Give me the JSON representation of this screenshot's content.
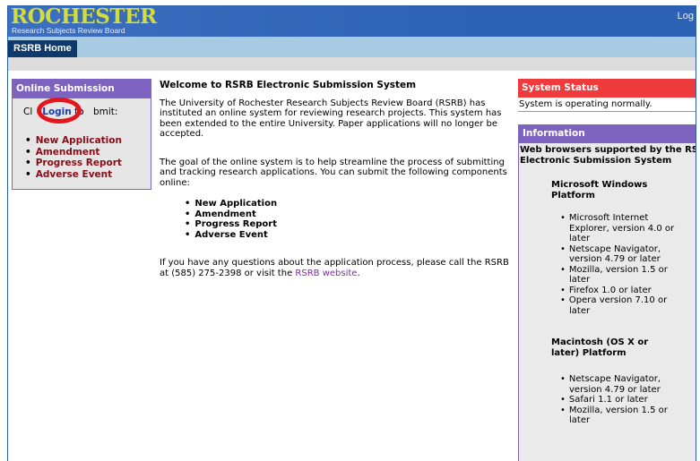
{
  "header": {
    "logo_main": "ROCHESTER",
    "logo_sub": "Research Subjects Review Board",
    "log_link": "Log"
  },
  "nav": {
    "tab_home": "RSRB Home"
  },
  "left_panel": {
    "title": "Online Submission",
    "prefix": "Cl",
    "login_link": "Login",
    "to": " to ",
    "suffix": "bmit:",
    "items": [
      "New Application",
      "Amendment",
      "Progress Report",
      "Adverse Event"
    ]
  },
  "center": {
    "title": "Welcome to RSRB Electronic Submission System",
    "para1": "The University of Rochester Research Subjects Review Board (RSRB) has instituted an online system for reviewing research projects.  This system has been extended to the entire University.  Paper applications will no longer be accepted.",
    "para2": "The goal of the online system is to help streamline the process of submitting and tracking research applications.  You can submit the following components online:",
    "items": [
      "New Application",
      "Amendment",
      "Progress Report",
      "Adverse Event"
    ],
    "contact_prefix": "If you have any questions about the application process, please call the RSRB at (585) 275-2398 or visit the ",
    "contact_link": "RSRB website",
    "contact_suffix": "."
  },
  "status": {
    "title": "System Status",
    "text": "System is operating normally."
  },
  "info": {
    "title": "Information",
    "heading": "Web browsers supported by the RSRB Electronic Submission System",
    "windows_title": "Microsoft Windows Platform",
    "windows_items": [
      "Microsoft Internet Explorer, version 4.0 or later",
      "Netscape Navigator, version 4.79 or later",
      "Mozilla, version 1.5 or later",
      "Firefox 1.0 or later",
      "Opera version 7.10 or later"
    ],
    "mac_title": "Macintosh (OS X or later) Platform",
    "mac_items": [
      "Netscape Navigator, version 4.79 or later",
      "Safari 1.1 or later",
      "Mozilla, version 1.5 or later"
    ]
  },
  "colors": {
    "banner": "#2f63b5",
    "logo": "#d2dc3a",
    "nav_bar": "#a9cae3",
    "nav_tab": "#0e3a6b",
    "panel_purple": "#7e62c0",
    "status_red": "#ef3b3b",
    "annotation_ring": "#e5141d",
    "component_link": "#8a0d16"
  }
}
